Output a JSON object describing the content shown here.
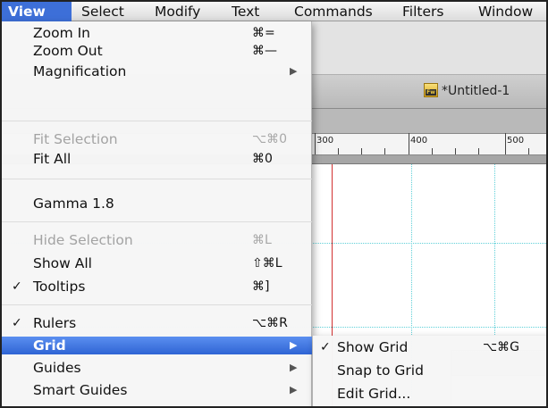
{
  "menubar": {
    "items": [
      {
        "label": "View",
        "active": true
      },
      {
        "label": "Select"
      },
      {
        "label": "Modify"
      },
      {
        "label": "Text"
      },
      {
        "label": "Commands"
      },
      {
        "label": "Filters"
      },
      {
        "label": "Window"
      }
    ]
  },
  "document": {
    "tab_title": "*Untitled-1",
    "icon_text": "Fw"
  },
  "ruler": {
    "labels": [
      "300",
      "400",
      "500"
    ]
  },
  "view_menu": {
    "items": [
      {
        "label": "Zoom In",
        "shortcut": "⌘=",
        "checked": "",
        "submenu": false,
        "disabled": false
      },
      {
        "label": "Zoom Out",
        "shortcut": "⌘—",
        "checked": "",
        "submenu": false,
        "disabled": false
      },
      {
        "label": "Magnification",
        "shortcut": "",
        "checked": "",
        "submenu": true,
        "disabled": false
      },
      {
        "label": "Fit Selection",
        "shortcut": "⌥⌘0",
        "checked": "",
        "submenu": false,
        "disabled": true
      },
      {
        "label": "Fit All",
        "shortcut": "⌘0",
        "checked": "",
        "submenu": false,
        "disabled": false
      },
      {
        "label": "Gamma 1.8",
        "shortcut": "",
        "checked": "",
        "submenu": false,
        "disabled": false
      },
      {
        "label": "Hide Selection",
        "shortcut": "⌘L",
        "checked": "",
        "submenu": false,
        "disabled": true
      },
      {
        "label": "Show All",
        "shortcut": "⇧⌘L",
        "checked": "",
        "submenu": false,
        "disabled": false
      },
      {
        "label": "Tooltips",
        "shortcut": "⌘]",
        "checked": "✓",
        "submenu": false,
        "disabled": false
      },
      {
        "label": "Rulers",
        "shortcut": "⌥⌘R",
        "checked": "✓",
        "submenu": false,
        "disabled": false
      },
      {
        "label": "Grid",
        "shortcut": "",
        "checked": "",
        "submenu": true,
        "disabled": false,
        "highlighted": true
      },
      {
        "label": "Guides",
        "shortcut": "",
        "checked": "",
        "submenu": true,
        "disabled": false
      },
      {
        "label": "Smart Guides",
        "shortcut": "",
        "checked": "",
        "submenu": true,
        "disabled": false
      }
    ],
    "arrow": "▶"
  },
  "grid_menu": {
    "items": [
      {
        "label": "Show Grid",
        "shortcut": "⌥⌘G",
        "checked": "✓"
      },
      {
        "label": "Snap to Grid",
        "shortcut": "",
        "checked": ""
      },
      {
        "label": "Edit Grid...",
        "shortcut": "",
        "checked": ""
      }
    ]
  }
}
